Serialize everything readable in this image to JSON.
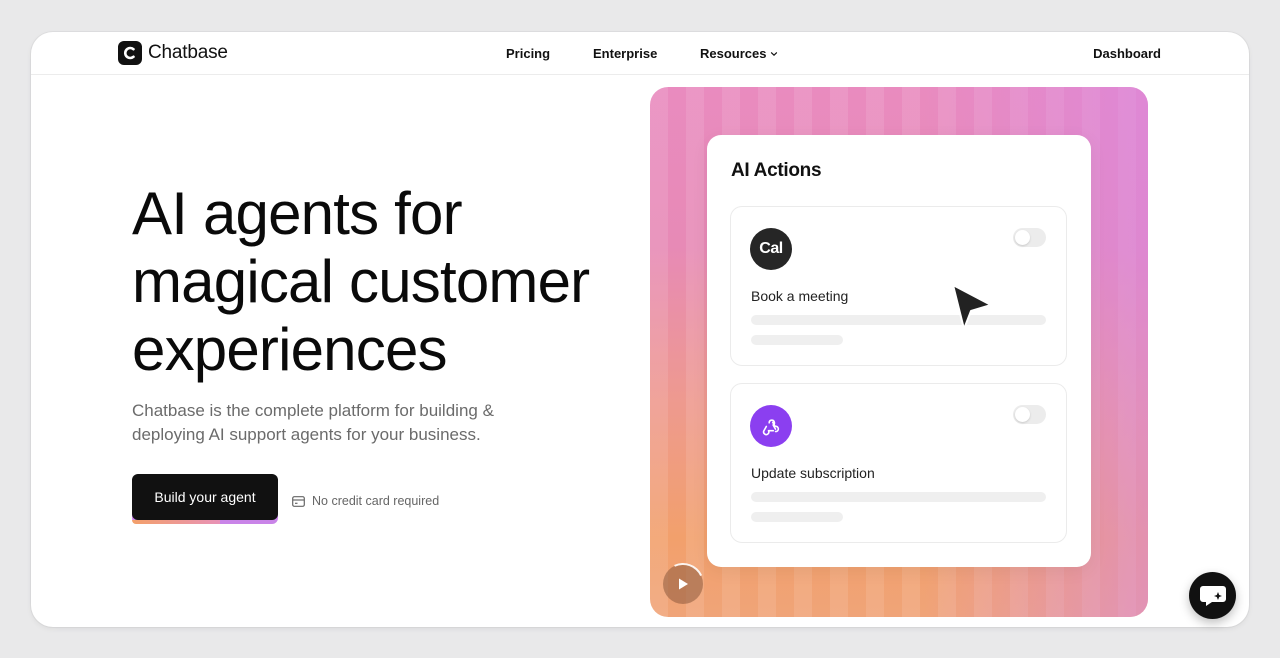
{
  "brand": {
    "name": "Chatbase"
  },
  "nav": {
    "links": [
      "Pricing",
      "Enterprise",
      "Resources"
    ],
    "dashboard": "Dashboard"
  },
  "hero": {
    "title_lines": [
      "AI agents for",
      "magical customer",
      "experiences"
    ],
    "subtitle_lines": [
      "Chatbase is the complete platform for building &",
      "deploying AI support agents for your business."
    ],
    "cta_label": "Build your agent",
    "note": "No credit card required"
  },
  "panel": {
    "title": "AI Actions",
    "actions": [
      {
        "icon_text": "Cal",
        "icon": "cal-logo-icon",
        "label": "Book a meeting",
        "enabled": false
      },
      {
        "icon": "webhook-icon",
        "label": "Update subscription",
        "enabled": false
      }
    ]
  },
  "colors": {
    "accent_purple": "#8b3ff0",
    "gradient_pink": "#e98bbf",
    "gradient_orange": "#f2a06c",
    "primary_dark": "#111111"
  }
}
